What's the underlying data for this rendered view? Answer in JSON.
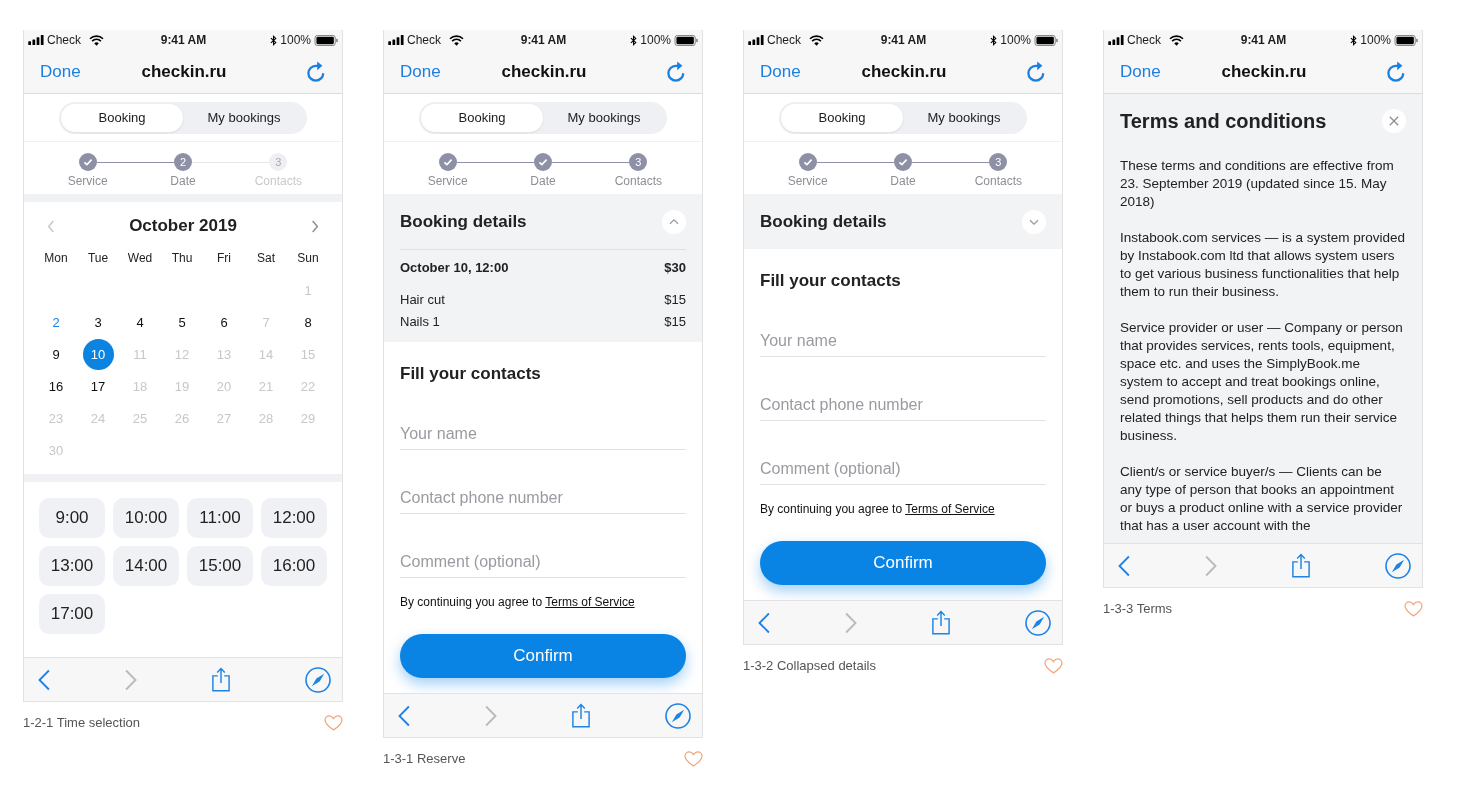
{
  "screens": [
    {
      "kind": "time_selection",
      "status_bar": {
        "carrier": "Check",
        "time": "9:41 AM",
        "battery": "100%"
      },
      "nav_bar": {
        "done": "Done",
        "title": "checkin.ru"
      },
      "segments": [
        {
          "label": "Booking",
          "selected": true
        },
        {
          "label": "My bookings",
          "selected": false
        }
      ],
      "steps": [
        {
          "label": "Service",
          "done": true,
          "current": false
        },
        {
          "number": "2",
          "label": "Date",
          "done": false,
          "current": true
        },
        {
          "number": "3",
          "label": "Contacts",
          "done": false,
          "current": false
        }
      ],
      "calendar": {
        "month": "October 2019",
        "prev": {
          "disabled": true
        },
        "next": {
          "disabled": false
        },
        "weekdays": [
          "Mon",
          "Tue",
          "Wed",
          "Thu",
          "Fri",
          "Sat",
          "Sun"
        ],
        "weeks": [
          [
            {
              "day": "1",
              "available": false,
              "selected": false,
              "today": false
            }
          ],
          [
            {
              "day": "2",
              "available": true,
              "selected": false,
              "today": true
            },
            {
              "day": "3",
              "available": true,
              "selected": false,
              "today": false
            },
            {
              "day": "4",
              "available": true,
              "selected": false,
              "today": false
            },
            {
              "day": "5",
              "available": true,
              "selected": false,
              "today": false
            },
            {
              "day": "6",
              "available": true,
              "selected": false,
              "today": false
            },
            {
              "day": "7",
              "available": false,
              "selected": false,
              "today": false
            },
            {
              "day": "8",
              "available": true,
              "selected": false,
              "today": false
            }
          ],
          [
            {
              "day": "9",
              "available": true,
              "selected": false,
              "today": false
            },
            {
              "day": "10",
              "available": true,
              "selected": true,
              "today": false
            },
            {
              "day": "11",
              "available": false,
              "selected": false,
              "today": false
            },
            {
              "day": "12",
              "available": false,
              "selected": false,
              "today": false
            },
            {
              "day": "13",
              "available": false,
              "selected": false,
              "today": false
            },
            {
              "day": "14",
              "available": false,
              "selected": false,
              "today": false
            },
            {
              "day": "15",
              "available": false,
              "selected": false,
              "today": false
            }
          ],
          [
            {
              "day": "16",
              "available": true,
              "selected": false,
              "today": false
            },
            {
              "day": "17",
              "available": true,
              "selected": false,
              "today": false
            },
            {
              "day": "18",
              "available": false,
              "selected": false,
              "today": false
            },
            {
              "day": "19",
              "available": false,
              "selected": false,
              "today": false
            },
            {
              "day": "20",
              "available": false,
              "selected": false,
              "today": false
            },
            {
              "day": "21",
              "available": false,
              "selected": false,
              "today": false
            },
            {
              "day": "22",
              "available": false,
              "selected": false,
              "today": false
            }
          ],
          [
            {
              "day": "23",
              "available": false,
              "selected": false,
              "today": false
            },
            {
              "day": "24",
              "available": false,
              "selected": false,
              "today": false
            },
            {
              "day": "25",
              "available": false,
              "selected": false,
              "today": false
            },
            {
              "day": "26",
              "available": false,
              "selected": false,
              "today": false
            },
            {
              "day": "27",
              "available": false,
              "selected": false,
              "today": false
            },
            {
              "day": "28",
              "available": false,
              "selected": false,
              "today": false
            },
            {
              "day": "29",
              "available": false,
              "selected": false,
              "today": false
            }
          ],
          [
            {
              "day": "30",
              "available": false,
              "selected": false,
              "today": false
            }
          ]
        ]
      },
      "time_slots": [
        {
          "time": "9:00",
          "selected": false
        },
        {
          "time": "10:00",
          "selected": false
        },
        {
          "time": "11:00",
          "selected": false
        },
        {
          "time": "12:00",
          "selected": false
        },
        {
          "time": "13:00",
          "selected": false
        },
        {
          "time": "14:00",
          "selected": false
        },
        {
          "time": "15:00",
          "selected": false
        },
        {
          "time": "16:00",
          "selected": false
        },
        {
          "time": "17:00",
          "selected": false
        }
      ],
      "toolbar": [
        {
          "kind": "back",
          "disabled": false
        },
        {
          "kind": "forward",
          "disabled": true
        },
        {
          "kind": "share",
          "disabled": false
        },
        {
          "kind": "compass",
          "disabled": false
        }
      ],
      "caption": "1-2-1 Time selection"
    },
    {
      "kind": "contacts",
      "status_bar": {
        "carrier": "Check",
        "time": "9:41 AM",
        "battery": "100%"
      },
      "nav_bar": {
        "done": "Done",
        "title": "checkin.ru"
      },
      "segments": [
        {
          "label": "Booking",
          "selected": true
        },
        {
          "label": "My bookings",
          "selected": false
        }
      ],
      "steps": [
        {
          "label": "Service",
          "done": true,
          "current": false
        },
        {
          "label": "Date",
          "done": true,
          "current": false
        },
        {
          "number": "3",
          "label": "Contacts",
          "done": false,
          "current": true
        }
      ],
      "booking_details": {
        "title": "Booking details",
        "expanded": true,
        "summary": {
          "label": "October 10, 12:00",
          "price": "$30"
        },
        "items": [
          {
            "name": "Hair cut",
            "price": "$15"
          },
          {
            "name": "Nails 1",
            "price": "$15"
          }
        ]
      },
      "contacts": {
        "title": "Fill your contacts",
        "fields": [
          {
            "placeholder": "Your name"
          },
          {
            "placeholder": "Contact phone number"
          },
          {
            "placeholder": "Comment (optional)"
          }
        ],
        "agreement": {
          "text": "By continuing you agree to",
          "link": "Terms of Service"
        },
        "confirm": "Confirm"
      },
      "toolbar": [
        {
          "kind": "back",
          "disabled": false
        },
        {
          "kind": "forward",
          "disabled": true
        },
        {
          "kind": "share",
          "disabled": false
        },
        {
          "kind": "compass",
          "disabled": false
        }
      ],
      "caption": "1-3-1 Reserve"
    },
    {
      "kind": "contacts",
      "status_bar": {
        "carrier": "Check",
        "time": "9:41 AM",
        "battery": "100%"
      },
      "nav_bar": {
        "done": "Done",
        "title": "checkin.ru"
      },
      "segments": [
        {
          "label": "Booking",
          "selected": true
        },
        {
          "label": "My bookings",
          "selected": false
        }
      ],
      "steps": [
        {
          "label": "Service",
          "done": true,
          "current": false
        },
        {
          "label": "Date",
          "done": true,
          "current": false
        },
        {
          "number": "3",
          "label": "Contacts",
          "done": false,
          "current": true
        }
      ],
      "booking_details": {
        "title": "Booking details",
        "expanded": false
      },
      "contacts": {
        "title": "Fill your contacts",
        "fields": [
          {
            "placeholder": "Your name"
          },
          {
            "placeholder": "Contact phone number"
          },
          {
            "placeholder": "Comment (optional)"
          }
        ],
        "agreement": {
          "text": "By continuing you agree to",
          "link": "Terms of Service"
        },
        "confirm": "Confirm"
      },
      "toolbar": [
        {
          "kind": "back",
          "disabled": false
        },
        {
          "kind": "forward",
          "disabled": true
        },
        {
          "kind": "share",
          "disabled": false
        },
        {
          "kind": "compass",
          "disabled": false
        }
      ],
      "caption": "1-3-2 Collapsed details"
    },
    {
      "kind": "terms",
      "status_bar": {
        "carrier": "Check",
        "time": "9:41 AM",
        "battery": "100%"
      },
      "nav_bar": {
        "done": "Done",
        "title": "checkin.ru"
      },
      "terms": {
        "title": "Terms and conditions",
        "paragraphs": [
          "These terms and conditions are effective from 23. September 2019 (updated since 15. May 2018)",
          "Instabook.com services — is a system provided by Instabook.com ltd that allows system users to get various business functionalities that help them to run their business.",
          "Service provider or user — Company or person that provides services, rents tools, equipment, space etc. and uses the SimplyBook.me system to accept and treat bookings online, send promotions, sell products and do other related things that helps them run their service business.",
          "Client/s or service buyer/s — Clients can be any type of person that books an appointment or buys a product online with a service provider that has a user account with the"
        ]
      },
      "toolbar": [
        {
          "kind": "back",
          "disabled": false
        },
        {
          "kind": "forward",
          "disabled": true
        },
        {
          "kind": "share",
          "disabled": false
        },
        {
          "kind": "compass",
          "disabled": false
        }
      ],
      "caption": "1-3-3 Terms"
    }
  ]
}
